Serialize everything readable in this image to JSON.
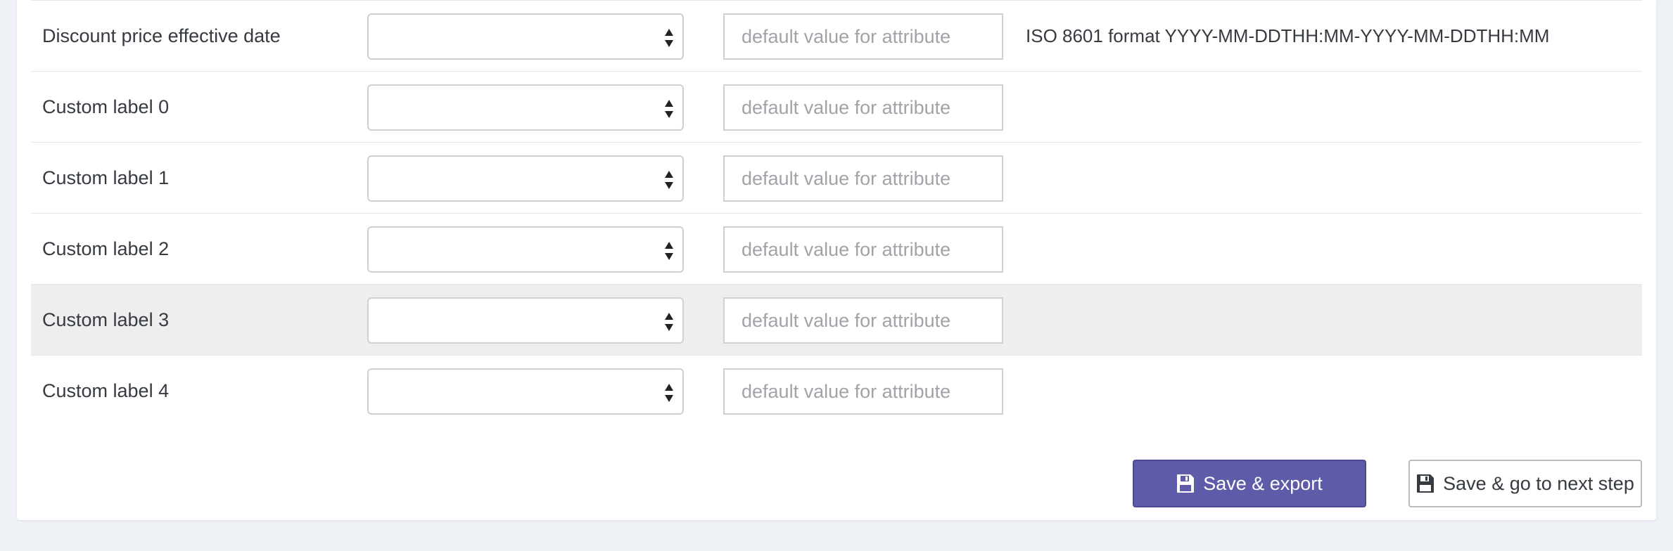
{
  "rows": [
    {
      "label": "Discount price effective date",
      "select_value": "",
      "input_placeholder": "default value for attribute",
      "hint": "ISO 8601 format YYYY-MM-DDTHH:MM-YYYY-MM-DDTHH:MM"
    },
    {
      "label": "Custom label 0",
      "select_value": "",
      "input_placeholder": "default value for attribute",
      "hint": ""
    },
    {
      "label": "Custom label 1",
      "select_value": "",
      "input_placeholder": "default value for attribute",
      "hint": ""
    },
    {
      "label": "Custom label 2",
      "select_value": "",
      "input_placeholder": "default value for attribute",
      "hint": ""
    },
    {
      "label": "Custom label 3",
      "select_value": "",
      "input_placeholder": "default value for attribute",
      "hint": ""
    },
    {
      "label": "Custom label 4",
      "select_value": "",
      "input_placeholder": "default value for attribute",
      "hint": ""
    }
  ],
  "actions": {
    "save_export_label": "Save & export",
    "save_next_label": "Save & go to next step",
    "save_icon": "floppy-disk-icon"
  },
  "colors": {
    "primary": "#5e5ba8",
    "background": "#eef1f5",
    "row_hover": "#eeeeee"
  }
}
